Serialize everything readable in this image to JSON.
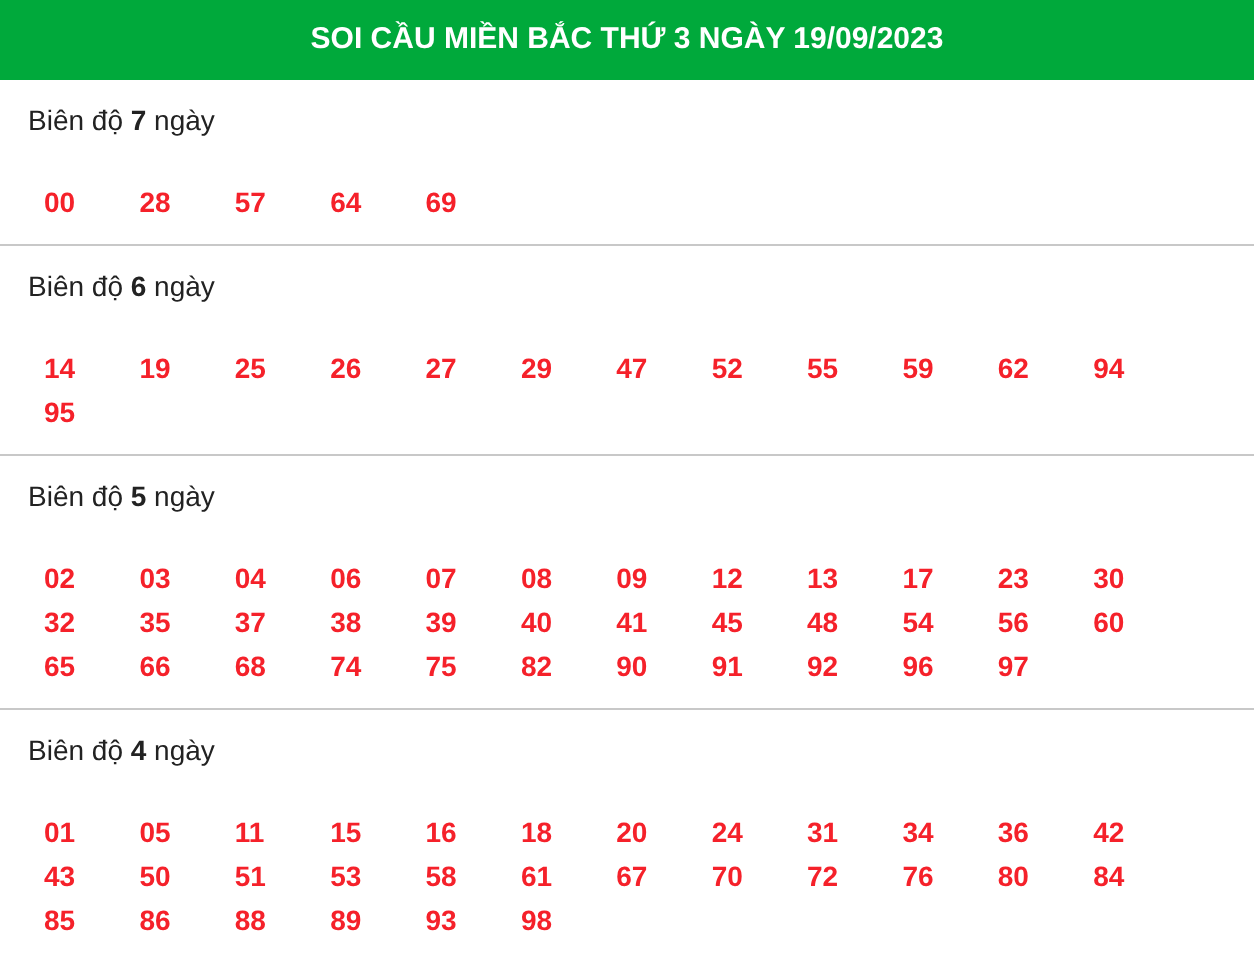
{
  "title": "SOI CẦU MIỀN BẮC THỨ 3 NGÀY 19/09/2023",
  "sections": [
    {
      "heading": "Biên độ **7** ngày",
      "numbers": [
        "00",
        "28",
        "57",
        "64",
        "69"
      ]
    },
    {
      "heading": "Biên độ **6** ngày",
      "numbers": [
        "14",
        "19",
        "25",
        "26",
        "27",
        "29",
        "47",
        "52",
        "55",
        "59",
        "62",
        "94",
        "95"
      ]
    },
    {
      "heading": "Biên độ **5** ngày",
      "numbers": [
        "02",
        "03",
        "04",
        "06",
        "07",
        "08",
        "09",
        "12",
        "13",
        "17",
        "23",
        "30",
        "32",
        "35",
        "37",
        "38",
        "39",
        "40",
        "41",
        "45",
        "48",
        "54",
        "56",
        "60",
        "65",
        "66",
        "68",
        "74",
        "75",
        "82",
        "90",
        "91",
        "92",
        "96",
        "97"
      ]
    },
    {
      "heading": "Biên độ **4** ngày",
      "numbers": [
        "01",
        "05",
        "11",
        "15",
        "16",
        "18",
        "20",
        "24",
        "31",
        "34",
        "36",
        "42",
        "43",
        "50",
        "51",
        "53",
        "58",
        "61",
        "67",
        "70",
        "72",
        "76",
        "80",
        "84",
        "85",
        "86",
        "88",
        "89",
        "93",
        "98"
      ]
    }
  ]
}
